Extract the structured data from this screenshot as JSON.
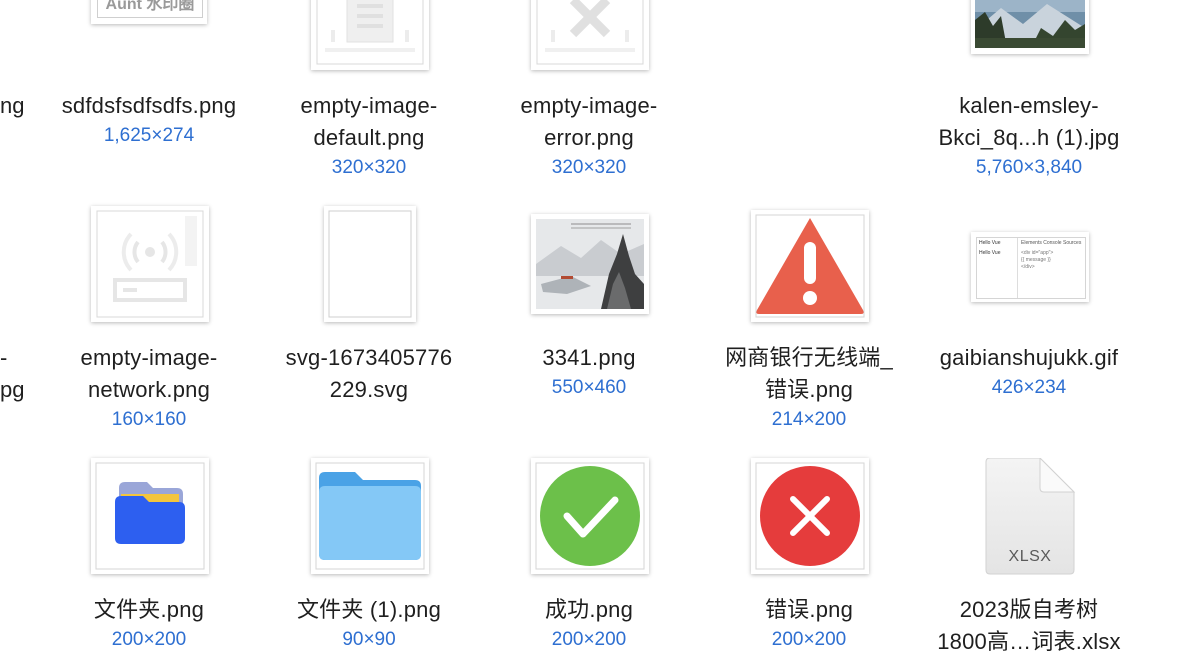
{
  "files": [
    {
      "id": "edge-row1",
      "name_lines": [
        "ng"
      ]
    },
    {
      "id": "sdfd",
      "name_lines": [
        "sdfdsfsdfsdfs.png"
      ],
      "dims": "1,625×274",
      "watermark_text": "Aunt 水印圈"
    },
    {
      "id": "empty-default",
      "name_lines": [
        "empty-image-",
        "default.png"
      ],
      "dims": "320×320"
    },
    {
      "id": "empty-error",
      "name_lines": [
        "empty-image-",
        "error.png"
      ],
      "dims": "320×320"
    },
    {
      "id": "kalen",
      "name_lines": [
        "kalen-emsley-",
        "Bkci_8q...h (1).jpg"
      ],
      "dims": "5,760×3,840"
    },
    {
      "id": "edge-row2",
      "name_lines": [
        "-",
        "pg"
      ]
    },
    {
      "id": "empty-network",
      "name_lines": [
        "empty-image-",
        "network.png"
      ],
      "dims": "160×160"
    },
    {
      "id": "svg-file",
      "name_lines": [
        "svg-1673405776",
        "229.svg"
      ]
    },
    {
      "id": "f3341",
      "name_lines": [
        "3341.png"
      ],
      "dims": "550×460"
    },
    {
      "id": "wangshang",
      "name_lines": [
        "网商银行无线端_",
        "错误.png"
      ],
      "dims": "214×200"
    },
    {
      "id": "gaibian",
      "name_lines": [
        "gaibianshujukk.gif"
      ],
      "dims": "426×234",
      "preview": {
        "title": "Hello Vue",
        "code": [
          "<div id=\"app\">",
          "{{ message }}",
          "</div>"
        ],
        "tabs": [
          "Elements",
          "Console",
          "Sources"
        ]
      }
    },
    {
      "id": "folder-png",
      "name_lines": [
        "文件夹.png"
      ],
      "dims": "200×200"
    },
    {
      "id": "folder-1",
      "name_lines": [
        "文件夹 (1).png"
      ],
      "dims": "90×90"
    },
    {
      "id": "success",
      "name_lines": [
        "成功.png"
      ],
      "dims": "200×200"
    },
    {
      "id": "error",
      "name_lines": [
        "错误.png"
      ],
      "dims": "200×200"
    },
    {
      "id": "xlsx",
      "name_lines": [
        "2023版自考树",
        "1800高…词表.xlsx"
      ],
      "doc_label": "XLSX"
    }
  ],
  "colors": {
    "name_text": "#1f1f1f",
    "dims_text": "#2e6fd1",
    "warning_red": "#e8604c",
    "success_green": "#6cc04a",
    "error_red": "#e53c3c",
    "folder_blue": "#2d5ff0",
    "folder_light_blue": "#7ec3f5"
  }
}
